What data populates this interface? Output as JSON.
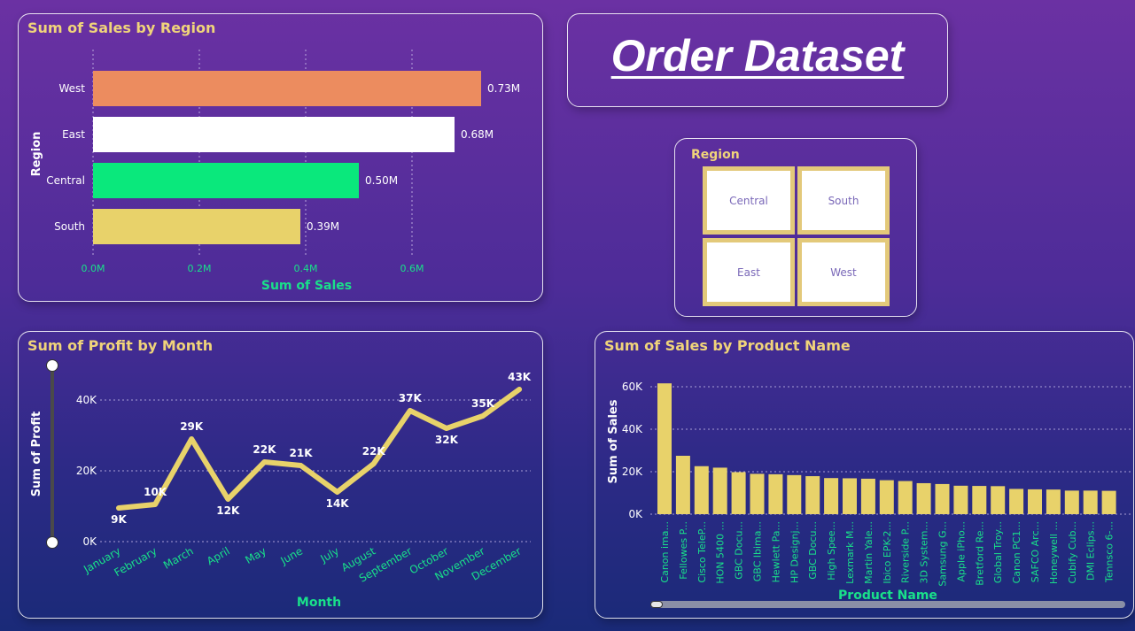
{
  "dashboard_title": "Order Dataset",
  "colors": {
    "accent_text": "#f0d47a",
    "axis_text": "#19e08a",
    "bar_yellow": "#e8d26a"
  },
  "slicer": {
    "title": "Region",
    "tiles": [
      "Central",
      "South",
      "East",
      "West"
    ]
  },
  "chart_data": [
    {
      "type": "bar",
      "orientation": "horizontal",
      "title": "Sum of Sales by Region",
      "xlabel": "Sum of Sales",
      "ylabel": "Region",
      "categories": [
        "West",
        "East",
        "Central",
        "South"
      ],
      "values": [
        0.73,
        0.68,
        0.5,
        0.39
      ],
      "data_labels": [
        "0.73M",
        "0.68M",
        "0.50M",
        "0.39M"
      ],
      "bar_colors": [
        "#ec8c5f",
        "#ffffff",
        "#0ae87c",
        "#e8d26a"
      ],
      "x_ticks": [
        "0.0M",
        "0.2M",
        "0.4M",
        "0.6M"
      ],
      "x_tick_values": [
        0,
        0.2,
        0.4,
        0.6
      ],
      "xlim": [
        0,
        0.8
      ],
      "unit": "M",
      "grid": true
    },
    {
      "type": "line",
      "title": "Sum of Profit by Month",
      "xlabel": "Month",
      "ylabel": "Sum of Profit",
      "categories": [
        "January",
        "February",
        "March",
        "April",
        "May",
        "June",
        "July",
        "August",
        "September",
        "October",
        "November",
        "December"
      ],
      "values": [
        9.5,
        10.5,
        29,
        12,
        22.5,
        21.5,
        14,
        22,
        37,
        32,
        35.5,
        43
      ],
      "data_labels": [
        "9K",
        "10K",
        "29K",
        "12K",
        "22K",
        "21K",
        "14K",
        "22K",
        "37K",
        "32K",
        "35K",
        "43K"
      ],
      "y_ticks": [
        "0K",
        "20K",
        "40K"
      ],
      "y_tick_values": [
        0,
        20,
        40
      ],
      "ylim": [
        0,
        46
      ],
      "unit": "K",
      "grid": true
    },
    {
      "type": "bar",
      "orientation": "vertical",
      "title": "Sum of Sales by Product Name",
      "xlabel": "Product Name",
      "ylabel": "Sum of Sales",
      "categories": [
        "Canon ima...",
        "Fellowes P...",
        "Cisco TeleP...",
        "HON 5400 ...",
        "GBC Docu...",
        "GBC Ibima...",
        "Hewlett Pa...",
        "HP Designj...",
        "GBC Docu...",
        "High Spee...",
        "Lexmark M...",
        "Martin Yale...",
        "Ibico EPK-2...",
        "Riverside P...",
        "3D System...",
        "Samsung G...",
        "Apple iPho...",
        "Bretford Re...",
        "Global Troy...",
        "Canon PC1...",
        "SAFCO Arc...",
        "Honeywell ...",
        "Cubify Cub...",
        "DMI Eclips...",
        "Tennsco 6-..."
      ],
      "values": [
        61.6,
        27.5,
        22.6,
        21.9,
        19.8,
        19.0,
        18.8,
        18.4,
        17.9,
        17.0,
        16.9,
        16.7,
        16.0,
        15.6,
        14.6,
        14.2,
        13.4,
        13.3,
        13.2,
        11.9,
        11.7,
        11.6,
        11.1,
        11.1,
        11.0
      ],
      "y_ticks": [
        "0K",
        "20K",
        "40K",
        "60K"
      ],
      "y_tick_values": [
        0,
        20,
        40,
        60
      ],
      "ylim": [
        0,
        65
      ],
      "unit": "K",
      "grid": true
    }
  ]
}
